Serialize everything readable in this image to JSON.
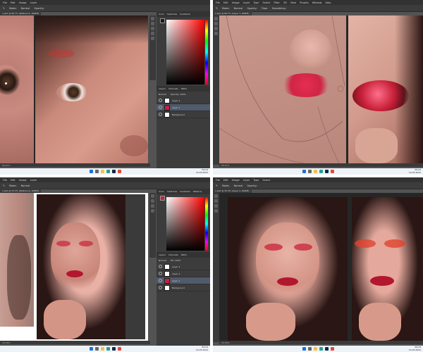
{
  "ps": {
    "menu": [
      "File",
      "Edit",
      "Image",
      "Layer",
      "Type",
      "Select",
      "Filter",
      "3D",
      "View",
      "Plugins",
      "Window",
      "Help"
    ],
    "options": [
      "Brush",
      "Mode:",
      "Normal",
      "Opacity:",
      "Flow:",
      "Smoothing:"
    ],
    "tl_doc_tab": "1.psd @ 66.7% (Reference, RGB/8)",
    "tr_doc_tab": "1.psd @ 66.7% (Layer 1, RGB/8)",
    "bl_doc_tab": "1.psd @ 33.3% (Reference, RGB/8)",
    "br_doc_tab": "1.psd @ 33.3% (Layer 2, RGB/8)",
    "panel_tabs": [
      "Color",
      "Swatches",
      "Gradients",
      "Patterns"
    ],
    "layer_tabs": [
      "Layers",
      "Channels",
      "Paths"
    ],
    "blend_mode": "Normal",
    "opacity": "Opacity: 100%",
    "fill": "Fill: 100%",
    "layers_tl": [
      "Layer 2",
      "Layer 1",
      "Background"
    ],
    "layers_bl": [
      "Layer 3",
      "Layer 2",
      "Layer 1",
      "Background"
    ],
    "zoom_tl": "66.67%",
    "zoom_tr": "66.67%",
    "zoom_bl": "33.33%",
    "zoom_br": "33.33%",
    "time": "09:24",
    "date": "10.03.2022"
  },
  "colors": {
    "fg_swatch": "#1a1a1a",
    "accent_red": "#c9213a",
    "skin": "#d98c7c"
  },
  "icons": [
    "windows-icon",
    "search-icon",
    "explorer-icon",
    "edge-icon",
    "photoshop-icon",
    "chrome-icon",
    "eye-icon",
    "move-tool-icon",
    "brush-tool-icon"
  ]
}
